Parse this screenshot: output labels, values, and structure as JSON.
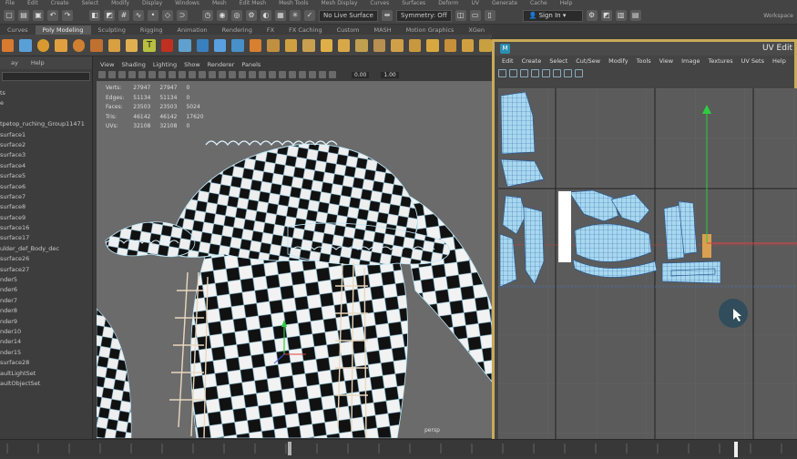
{
  "top_menu": [
    "File",
    "Edit",
    "Create",
    "Select",
    "Modify",
    "Display",
    "Windows",
    "Mesh",
    "Edit Mesh",
    "Mesh Tools",
    "Mesh Display",
    "Curves",
    "Surfaces",
    "Deform",
    "UV",
    "Generate",
    "Cache",
    "Help"
  ],
  "status_line": {
    "live_surface": "No Live Surface",
    "symmetry": "Symmetry: Off",
    "sign_in": "Sign In",
    "workspace": "Workspace"
  },
  "shelf_tabs": {
    "items": [
      "Curves",
      "Poly Modeling",
      "Sculpting",
      "Rigging",
      "Animation",
      "Rendering",
      "FX",
      "FX Caching",
      "Custom",
      "MASH",
      "Motion Graphics",
      "XGen"
    ],
    "active": "Poly Modeling"
  },
  "outliner": {
    "menu": [
      "ay",
      "Help"
    ],
    "items": [
      "ts",
      "e",
      "",
      "tpetop_ruching_Group11471",
      "surface1",
      "surface2",
      "surface3",
      "surface4",
      "surface5",
      "surface6",
      "surface7",
      "surface8",
      "surface9",
      "surface16",
      "surface17",
      "ulder_def_Body_dec",
      "surface26",
      "surface27",
      "nder5",
      "nder6",
      "nder7",
      "nder8",
      "nder9",
      "nder10",
      "nder14",
      "nder15",
      "surface28",
      "aultLightSet",
      "aultObjectSet"
    ]
  },
  "viewport": {
    "menu": [
      "View",
      "Shading",
      "Lighting",
      "Show",
      "Renderer",
      "Panels"
    ],
    "hud": [
      {
        "label": "Verts:",
        "a": "27947",
        "b": "27947",
        "c": "0"
      },
      {
        "label": "Edges:",
        "a": "51134",
        "b": "51134",
        "c": "0"
      },
      {
        "label": "Faces:",
        "a": "23503",
        "b": "23503",
        "c": "5024"
      },
      {
        "label": "Tris:",
        "a": "46142",
        "b": "46142",
        "c": "17620"
      },
      {
        "label": "UVs:",
        "a": "32108",
        "b": "32108",
        "c": "0"
      }
    ],
    "camera_label": "persp",
    "field1": "0.00",
    "field2": "1.00"
  },
  "uv_editor": {
    "title": "UV Edit",
    "logo": "M",
    "menu": [
      "Edit",
      "Create",
      "Select",
      "Cut/Sew",
      "Modify",
      "Tools",
      "View",
      "Image",
      "Textures",
      "UV Sets",
      "Help"
    ]
  },
  "colors": {
    "accent": "#c9aa59",
    "uv_shell": "#a8d8f0",
    "mesh_wire": "#bfe8f8",
    "manip_green": "#2ecc40"
  }
}
